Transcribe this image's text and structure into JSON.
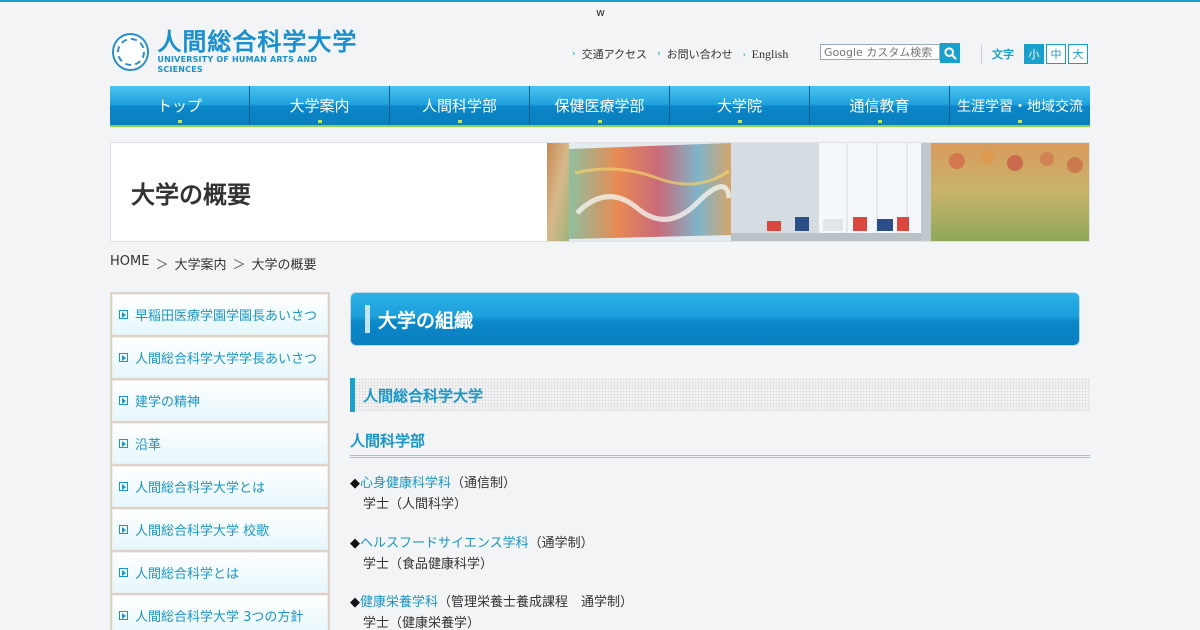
{
  "header": {
    "top_mark": "w",
    "logo": {
      "title_ja": "人間総合科学大学",
      "title_en": "UNIVERSITY OF HUMAN ARTS AND SCIENCES"
    },
    "util_links": [
      {
        "label": "交通アクセス"
      },
      {
        "label": "お問い合わせ"
      },
      {
        "label": "English"
      }
    ],
    "search": {
      "placeholder": "Google カスタム検索"
    },
    "font_size": {
      "label": "文字",
      "options": [
        "小",
        "中",
        "大"
      ],
      "selected": "小"
    }
  },
  "nav": {
    "items": [
      "トップ",
      "大学案内",
      "人間科学部",
      "保健医療学部",
      "大学院",
      "通信教育",
      "生涯学習・地域交流"
    ]
  },
  "banner": {
    "title": "大学の概要"
  },
  "breadcrumb": {
    "items": [
      "HOME",
      "大学案内",
      "大学の概要"
    ],
    "separator": "＞"
  },
  "sidebar": {
    "items": [
      "早稲田医療学園学園長あいさつ",
      "人間総合科学大学学長あいさつ",
      "建学の精神",
      "沿革",
      "人間総合科学大学とは",
      "人間総合科学大学 校歌",
      "人間総合科学とは",
      "人間総合科学大学 3つの方針"
    ]
  },
  "main": {
    "title": "大学の組織",
    "section": "人間総合科学大学",
    "subsection": "人間科学部",
    "programs": [
      {
        "marker": "◆",
        "name": "心身健康科学科",
        "note": "（通信制）",
        "degree": "学士（人間科学）"
      },
      {
        "marker": "◆",
        "name": "ヘルスフードサイエンス学科",
        "note": "（通学制）",
        "degree": "学士（食品健康科学）"
      },
      {
        "marker": "◆",
        "name": "健康栄養学科",
        "note": "（管理栄養士養成課程　通学制）",
        "degree": "学士（健康栄養学）"
      }
    ]
  },
  "colors": {
    "accent": "#1aa0cc",
    "nav_underline": "#8bd24b",
    "link": "#1b96c8"
  }
}
